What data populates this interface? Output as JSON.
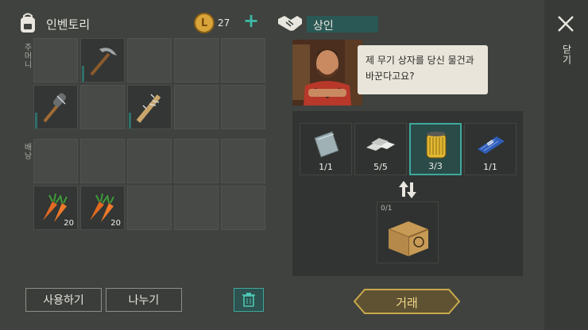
{
  "inventory": {
    "title": "인벤토리",
    "coins": "27",
    "add_symbol": "+",
    "pocket_label": "주머니",
    "backpack_label": "배낭",
    "pocket_slots": [
      {
        "item": "",
        "count": ""
      },
      {
        "item": "pickaxe",
        "count": ""
      },
      {
        "item": "",
        "count": ""
      },
      {
        "item": "",
        "count": ""
      },
      {
        "item": "",
        "count": ""
      },
      {
        "item": "spiked-club",
        "count": ""
      },
      {
        "item": "",
        "count": ""
      },
      {
        "item": "nailed-bat",
        "count": ""
      },
      {
        "item": "",
        "count": ""
      },
      {
        "item": "",
        "count": ""
      }
    ],
    "backpack_slots": [
      {
        "item": "",
        "count": ""
      },
      {
        "item": "",
        "count": ""
      },
      {
        "item": "",
        "count": ""
      },
      {
        "item": "",
        "count": ""
      },
      {
        "item": "",
        "count": ""
      },
      {
        "item": "carrot",
        "count": "20"
      },
      {
        "item": "carrot",
        "count": "20"
      },
      {
        "item": "",
        "count": ""
      },
      {
        "item": "",
        "count": ""
      },
      {
        "item": "",
        "count": ""
      }
    ],
    "use_label": "사용하기",
    "split_label": "나누기"
  },
  "trader": {
    "title": "상인",
    "message": "제 무기 상자를 당신 물건과 바꾼다고요?",
    "offer_items": [
      {
        "item": "metal-plate",
        "qty": "1/1"
      },
      {
        "item": "metal-ingots",
        "qty": "5/5"
      },
      {
        "item": "oil-filter",
        "qty": "3/3"
      },
      {
        "item": "circuit-board",
        "qty": "1/1"
      }
    ],
    "result_count": "0/1",
    "result_item": "weapon-crate",
    "trade_label": "거래"
  },
  "close_label": "닫기",
  "colors": {
    "accent_teal": "#3fa89c",
    "trade_gold": "#c9a94c",
    "background": "#3f423e"
  }
}
